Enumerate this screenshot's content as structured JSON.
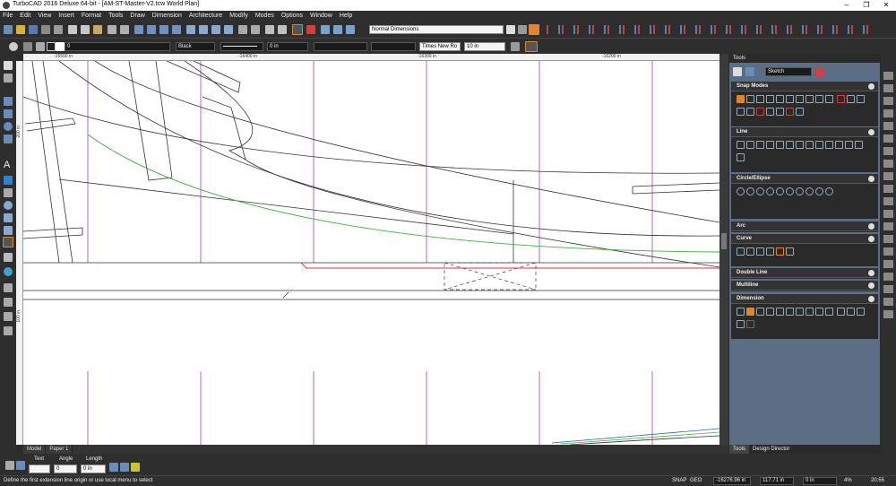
{
  "window": {
    "title": "TurboCAD 2016 Deluxe 64-bit - [AM-ST-Master-V2.tcw World Plan]"
  },
  "menu": [
    "File",
    "Edit",
    "View",
    "Insert",
    "Format",
    "Tools",
    "Draw",
    "Dimension",
    "Architecture",
    "Modify",
    "Modes",
    "Options",
    "Window",
    "Help"
  ],
  "toolbar": {
    "dimension_style": "Normal Dimensions",
    "layer_value": "0",
    "color_value": "Black",
    "line_width": "0 in",
    "font": "Times New Ro",
    "font_size": "10 in"
  },
  "ruler": {
    "top_labels": [
      "-16500 in",
      "-16400 in",
      "-16300 in",
      "-16200 in"
    ],
    "left_labels": [
      "200 in",
      "100 in"
    ]
  },
  "sheet_tabs": [
    "Model",
    "Paper 1"
  ],
  "palette": {
    "title": "Tools",
    "mode": "Sketch",
    "sections": [
      {
        "label": "Snap Modes",
        "icons": 20
      },
      {
        "label": "Line",
        "icons": 14
      },
      {
        "label": "Circle/Ellipse",
        "icons": 10
      },
      {
        "label": "Arc",
        "icons": 0
      },
      {
        "label": "Curve",
        "icons": 6
      },
      {
        "label": "Double Line",
        "icons": 0
      },
      {
        "label": "Multiline",
        "icons": 0
      },
      {
        "label": "Dimension",
        "icons": 15
      }
    ],
    "tabs": [
      "Tools",
      "Design Director"
    ]
  },
  "inspector": {
    "text_label": "Text",
    "angle_label": "Angle",
    "length_label": "Length",
    "angle_value": "0",
    "length_value": "0 in"
  },
  "status": {
    "message": "Define the first extension line origin or use local menu to select",
    "snap": "SNAP",
    "geo": "GEO",
    "x": "-16276.96 in",
    "y": "117.71 in",
    "z": "0 in",
    "zoom": "4%",
    "time": "20:55"
  },
  "colors": {
    "accent": "#e0862a",
    "canvas": "#ffffff",
    "purple_line": "#a040c0",
    "green_line": "#40b040",
    "red_line": "#e03030"
  }
}
